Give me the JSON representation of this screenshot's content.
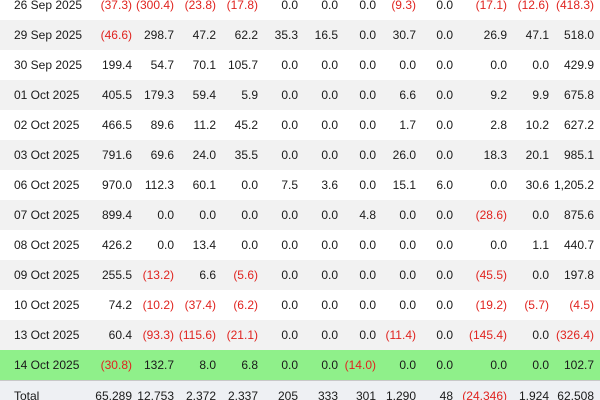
{
  "table": {
    "rows": [
      {
        "date": "26 Sep 2025",
        "values": [
          "(37.3)",
          "(300.4)",
          "(23.8)",
          "(17.8)",
          "0.0",
          "0.0",
          "0.0",
          "(9.3)",
          "0.0",
          "(17.1)",
          "(12.6)",
          "(418.3)"
        ]
      },
      {
        "date": "29 Sep 2025",
        "values": [
          "(46.6)",
          "298.7",
          "47.2",
          "62.2",
          "35.3",
          "16.5",
          "0.0",
          "30.7",
          "0.0",
          "26.9",
          "47.1",
          "518.0"
        ]
      },
      {
        "date": "30 Sep 2025",
        "values": [
          "199.4",
          "54.7",
          "70.1",
          "105.7",
          "0.0",
          "0.0",
          "0.0",
          "0.0",
          "0.0",
          "0.0",
          "0.0",
          "429.9"
        ]
      },
      {
        "date": "01 Oct 2025",
        "values": [
          "405.5",
          "179.3",
          "59.4",
          "5.9",
          "0.0",
          "0.0",
          "0.0",
          "6.6",
          "0.0",
          "9.2",
          "9.9",
          "675.8"
        ]
      },
      {
        "date": "02 Oct 2025",
        "values": [
          "466.5",
          "89.6",
          "11.2",
          "45.2",
          "0.0",
          "0.0",
          "0.0",
          "1.7",
          "0.0",
          "2.8",
          "10.2",
          "627.2"
        ]
      },
      {
        "date": "03 Oct 2025",
        "values": [
          "791.6",
          "69.6",
          "24.0",
          "35.5",
          "0.0",
          "0.0",
          "0.0",
          "26.0",
          "0.0",
          "18.3",
          "20.1",
          "985.1"
        ]
      },
      {
        "date": "06 Oct 2025",
        "values": [
          "970.0",
          "112.3",
          "60.1",
          "0.0",
          "7.5",
          "3.6",
          "0.0",
          "15.1",
          "6.0",
          "0.0",
          "30.6",
          "1,205.2"
        ]
      },
      {
        "date": "07 Oct 2025",
        "values": [
          "899.4",
          "0.0",
          "0.0",
          "0.0",
          "0.0",
          "0.0",
          "4.8",
          "0.0",
          "0.0",
          "(28.6)",
          "0.0",
          "875.6"
        ]
      },
      {
        "date": "08 Oct 2025",
        "values": [
          "426.2",
          "0.0",
          "13.4",
          "0.0",
          "0.0",
          "0.0",
          "0.0",
          "0.0",
          "0.0",
          "0.0",
          "1.1",
          "440.7"
        ]
      },
      {
        "date": "09 Oct 2025",
        "values": [
          "255.5",
          "(13.2)",
          "6.6",
          "(5.6)",
          "0.0",
          "0.0",
          "0.0",
          "0.0",
          "0.0",
          "(45.5)",
          "0.0",
          "197.8"
        ]
      },
      {
        "date": "10 Oct 2025",
        "values": [
          "74.2",
          "(10.2)",
          "(37.4)",
          "(6.2)",
          "0.0",
          "0.0",
          "0.0",
          "0.0",
          "0.0",
          "(19.2)",
          "(5.7)",
          "(4.5)"
        ]
      },
      {
        "date": "13 Oct 2025",
        "values": [
          "60.4",
          "(93.3)",
          "(115.6)",
          "(21.1)",
          "0.0",
          "0.0",
          "0.0",
          "(11.4)",
          "0.0",
          "(145.4)",
          "0.0",
          "(326.4)"
        ]
      },
      {
        "date": "14 Oct 2025",
        "values": [
          "(30.8)",
          "132.7",
          "8.0",
          "6.8",
          "0.0",
          "0.0",
          "(14.0)",
          "0.0",
          "0.0",
          "0.0",
          "0.0",
          "102.7"
        ],
        "highlight": true
      }
    ],
    "total": {
      "label": "Total",
      "values": [
        "65,289",
        "12,753",
        "2,372",
        "2,337",
        "205",
        "333",
        "301",
        "1,290",
        "48",
        "(24,346)",
        "1,924",
        "62,508"
      ]
    }
  },
  "colors": {
    "negative": "#e0231f",
    "highlight_row": "#8ff08a",
    "alt_row": "#f2f2f2"
  }
}
